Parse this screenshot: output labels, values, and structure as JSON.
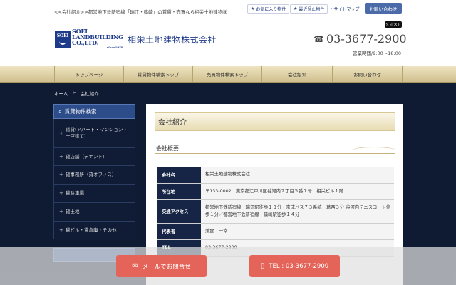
{
  "header": {
    "tagline": "<<会社紹介>>都営地下鉄新宿線「瑞江・篠崎」の賃貸・売買なら相栄土地建物㈱",
    "favorites_label": "お気に入り物件",
    "recent_label": "最近見た物件",
    "sitemap_label": "サイトマップ",
    "inquiry_button": "お問い合わせ",
    "xpost_label": "ポスト",
    "logo_line1": "SOEI",
    "logo_line2": "LANDBUILDING",
    "logo_line3": "CO.,LTD.",
    "logo_since": "since1979",
    "company_name": "相栄土地建物株式会社",
    "phone": "03-3677-2900",
    "hours": "営業時間/9:00～18:00"
  },
  "nav": {
    "items": [
      "トップページ",
      "賃貸物件検索トップ",
      "売買物件検索トップ",
      "会社紹介",
      "お問い合わせ"
    ]
  },
  "breadcrumb": {
    "home": "ホーム",
    "sep": ">",
    "current": "会社紹介"
  },
  "sidebar": {
    "title": "賃貸物件検索",
    "items": [
      "賃貸(アパート・マンション・一戸建て)",
      "貸店舗（テナント）",
      "貸事務所（貸オフィス）",
      "貸駐車場",
      "貸土地",
      "貸ビル・貸倉庫・その他"
    ]
  },
  "main": {
    "page_title": "会社紹介",
    "section_title": "会社概要",
    "table": [
      {
        "key": "会社名",
        "value": "相栄土地建物株式会社"
      },
      {
        "key": "所在地",
        "value": "〒133-0002　東京都江戸川区谷河内２丁目５番７号　相栄ビル１階"
      },
      {
        "key": "交通アクセス",
        "value": "都営地下鉄新宿線　瑞江駅徒歩１３分・京成バス７３系統　葛西３分 谷河内テニスコート停歩１分／都営地下鉄新宿線　篠崎駅徒歩１４分"
      },
      {
        "key": "代表者",
        "value": "蒲倉　一幸"
      },
      {
        "key": "TEL",
        "value": "03-3677-2900"
      }
    ]
  },
  "cta": {
    "mail_label": "メールでお問合せ",
    "tel_label": "TEL : 03-3677-2900"
  },
  "colors": {
    "navy": "#0f1a33",
    "gold": "#cfbf8e",
    "cta": "#e4645a"
  }
}
